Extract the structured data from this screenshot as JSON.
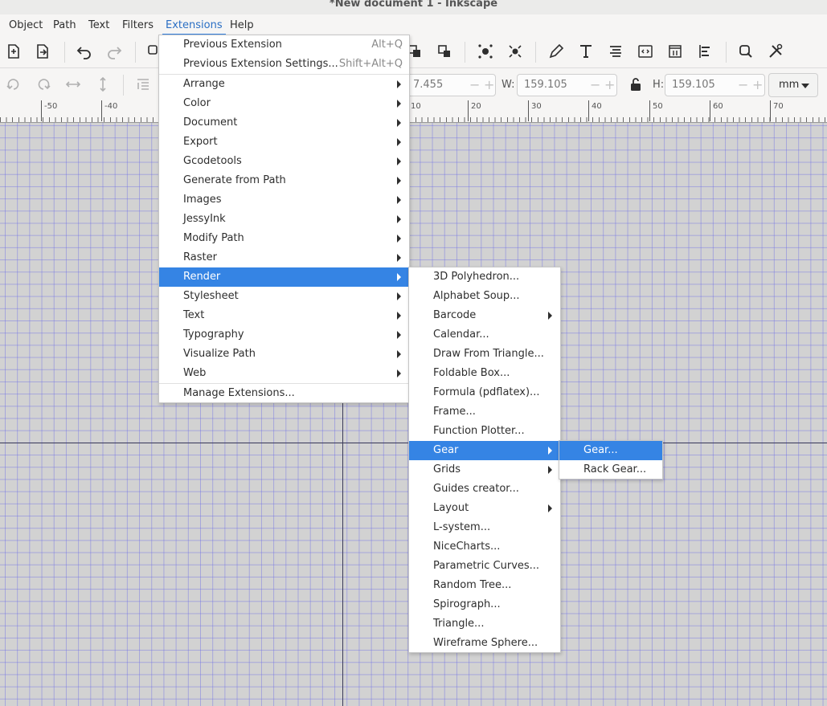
{
  "window": {
    "title": "*New document 1 - Inkscape"
  },
  "menubar": {
    "items": [
      "Object",
      "Path",
      "Text",
      "Filters",
      "Extensions",
      "Help"
    ],
    "active": "Extensions"
  },
  "toolbar2": {
    "x_value": "7.455",
    "w_label": "W:",
    "w_value": "159.105",
    "h_label": "H:",
    "h_value": "159.105",
    "units": "mm"
  },
  "ruler": {
    "labels": [
      "-50",
      "-40",
      "10",
      "20",
      "30",
      "40",
      "50",
      "60",
      "70"
    ]
  },
  "extensions_menu": {
    "previous_extension": {
      "label": "Previous Extension",
      "accel": "Alt+Q"
    },
    "previous_extension_settings": {
      "label": "Previous Extension Settings...",
      "accel": "Shift+Alt+Q"
    },
    "submenus": [
      "Arrange",
      "Color",
      "Document",
      "Export",
      "Gcodetools",
      "Generate from Path",
      "Images",
      "JessyInk",
      "Modify Path",
      "Raster",
      "Render",
      "Stylesheet",
      "Text",
      "Typography",
      "Visualize Path",
      "Web"
    ],
    "highlighted": "Render",
    "manage": "Manage Extensions..."
  },
  "render_menu": {
    "items": [
      {
        "label": "3D Polyhedron...",
        "submenu": false
      },
      {
        "label": "Alphabet Soup...",
        "submenu": false
      },
      {
        "label": "Barcode",
        "submenu": true
      },
      {
        "label": "Calendar...",
        "submenu": false
      },
      {
        "label": "Draw From Triangle...",
        "submenu": false
      },
      {
        "label": "Foldable Box...",
        "submenu": false
      },
      {
        "label": "Formula (pdflatex)...",
        "submenu": false
      },
      {
        "label": "Frame...",
        "submenu": false
      },
      {
        "label": "Function Plotter...",
        "submenu": false
      },
      {
        "label": "Gear",
        "submenu": true
      },
      {
        "label": "Grids",
        "submenu": true
      },
      {
        "label": "Guides creator...",
        "submenu": false
      },
      {
        "label": "Layout",
        "submenu": true
      },
      {
        "label": "L-system...",
        "submenu": false
      },
      {
        "label": "NiceCharts...",
        "submenu": false
      },
      {
        "label": "Parametric Curves...",
        "submenu": false
      },
      {
        "label": "Random Tree...",
        "submenu": false
      },
      {
        "label": "Spirograph...",
        "submenu": false
      },
      {
        "label": "Triangle...",
        "submenu": false
      },
      {
        "label": "Wireframe Sphere...",
        "submenu": false
      }
    ],
    "highlighted": "Gear"
  },
  "gear_menu": {
    "items": [
      "Gear...",
      "Rack Gear..."
    ],
    "highlighted": "Gear..."
  },
  "colors": {
    "highlight": "#3584e4",
    "canvas": "#d2d2d2",
    "grid": "#8a8ae6"
  },
  "toolbar1_icons": [
    "new-document-icon",
    "open-document-icon",
    "undo-icon",
    "redo-icon",
    "duplicate-icon",
    "group-icon",
    "ungroup-icon",
    "node-tool-icon",
    "snap-icon",
    "pen-icon",
    "text-tool-icon",
    "align-icon",
    "xml-editor-icon",
    "layers-icon",
    "distribute-icon",
    "zoom-icon",
    "preferences-icon"
  ]
}
